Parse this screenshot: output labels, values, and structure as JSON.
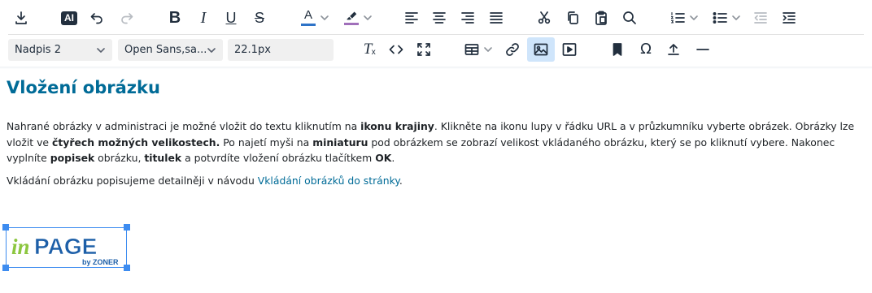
{
  "toolbar": {
    "row1": [
      {
        "id": "download",
        "icon": "download-icon"
      },
      {
        "id": "ai",
        "icon": "ai-icon",
        "label": "AI"
      },
      {
        "id": "undo",
        "icon": "undo-icon"
      },
      {
        "id": "redo",
        "icon": "redo-icon",
        "disabled": true
      },
      {
        "id": "bold",
        "icon": "bold-icon",
        "label": "B"
      },
      {
        "id": "italic",
        "icon": "italic-icon",
        "label": "I"
      },
      {
        "id": "underline",
        "icon": "underline-icon",
        "label": "U"
      },
      {
        "id": "strikethrough",
        "icon": "strikethrough-icon",
        "label": "S"
      },
      {
        "id": "text-color",
        "icon": "text-color-icon",
        "label": "A",
        "color": "#2e73c7"
      },
      {
        "id": "highlight",
        "icon": "highlight-icon",
        "color": "#a06fba"
      },
      {
        "id": "align-left",
        "icon": "align-left-icon"
      },
      {
        "id": "align-center",
        "icon": "align-center-icon"
      },
      {
        "id": "align-right",
        "icon": "align-right-icon"
      },
      {
        "id": "justify",
        "icon": "justify-icon"
      },
      {
        "id": "cut",
        "icon": "cut-icon"
      },
      {
        "id": "copy",
        "icon": "copy-icon"
      },
      {
        "id": "paste",
        "icon": "paste-icon"
      },
      {
        "id": "search",
        "icon": "search-icon"
      },
      {
        "id": "numbered-list",
        "icon": "numbered-list-icon"
      },
      {
        "id": "bullet-list",
        "icon": "bullet-list-icon"
      },
      {
        "id": "outdent",
        "icon": "outdent-icon",
        "disabled": true
      },
      {
        "id": "indent",
        "icon": "indent-icon"
      }
    ],
    "format_select": "Nadpis 2",
    "font_select": "Open Sans,sa...",
    "size_select": "22.1px",
    "row2": [
      {
        "id": "clear-format",
        "icon": "clear-format-icon"
      },
      {
        "id": "source-code",
        "icon": "source-code-icon"
      },
      {
        "id": "fullscreen",
        "icon": "fullscreen-icon"
      },
      {
        "id": "table",
        "icon": "table-icon"
      },
      {
        "id": "link",
        "icon": "link-icon"
      },
      {
        "id": "image",
        "icon": "image-icon",
        "active": true
      },
      {
        "id": "media",
        "icon": "media-icon"
      },
      {
        "id": "bookmark",
        "icon": "bookmark-icon"
      },
      {
        "id": "special-char",
        "icon": "omega-icon",
        "label": "Ω"
      },
      {
        "id": "insert-file",
        "icon": "upload-icon"
      },
      {
        "id": "horizontal-line",
        "icon": "horizontal-line-icon"
      }
    ],
    "active_color": "#cfe5fb"
  },
  "document": {
    "heading": "Vložení obrázku",
    "p1": {
      "t1": "Nahrané obrázky v administraci je možné vložit do textu kliknutím na ",
      "b1": "ikonu krajiny",
      "t2": ". Klikněte na ikonu lupy v řádku URL a v průzkumníku vyberte obrázek. Obrázky lze vložit ve ",
      "b2": "čtyřech možných velikostech.",
      "t3": " Po najetí myši na ",
      "b3": "miniaturu",
      "t4": " pod obrázkem se zobrazí velikost vkládaného obrázku, který se po kliknutí vybere. Nakonec vyplníte ",
      "b4": "popisek",
      "t5": " obrázku, ",
      "b5": "titulek",
      "t6": " a potvrdíte vložení obrázku tlačítkem ",
      "b6": "OK",
      "t7": "."
    },
    "p2": {
      "t1": "Vkládání obrázku popisujeme detailněji v návodu ",
      "link": "Vkládání obrázků do stránky",
      "t2": "."
    },
    "image": {
      "logo_in": "in",
      "logo_page": "PAGE",
      "logo_by": "by ZONER",
      "colors": {
        "green": "#8cc63f",
        "blue": "#1d5fa8",
        "selection": "#3d8cf0",
        "heading": "#006b97"
      }
    }
  }
}
